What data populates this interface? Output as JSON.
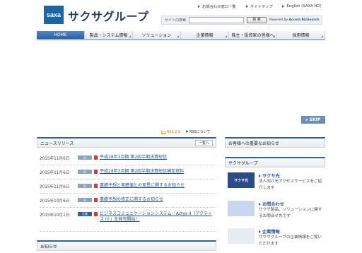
{
  "header": {
    "logo_text": "saxa",
    "brand": "サクサグループ",
    "util_links": [
      "お問合わせ窓口一覧",
      "サイトマップ",
      "English (SAXA HD)"
    ],
    "search_label": "サイト内検索",
    "search_placeholder": "",
    "search_button": "検 索",
    "powered_prefix": "Powered by",
    "powered_by": "Accela BizSearch"
  },
  "nav": [
    "HOME",
    "製品・システム情報",
    "ソリューション",
    "企業情報",
    "株主・投資家の皆様へ",
    "採用情報"
  ],
  "skip_label": "SKIP",
  "rss": {
    "badge": "RSS 2.0",
    "about": "RSSについて"
  },
  "news": {
    "heading": "ニュースリリース",
    "more": "一覧へ",
    "items": [
      {
        "date": "2015年11月6日",
        "tag": "IR",
        "title": "平成28年3月期 第2四半期決算短信"
      },
      {
        "date": "2015年11月6日",
        "tag": "IR",
        "title": "平成28年3月期 第2四半期決算短信補足資料"
      },
      {
        "date": "2015年11月6日",
        "tag": "IR",
        "title": "業績予想と実績値との差異に関するお知らせ"
      },
      {
        "date": "2015年10月6日",
        "tag": "IR",
        "title": "業績予想の修正に関するお知らせ"
      },
      {
        "date": "2015年10月1日",
        "tag": "企業",
        "title": "ビジネスコミュニケーションシステム「Actys II（アクティス II）」を発売開始！"
      }
    ]
  },
  "notice_heading": "お知らせ",
  "sidebar": {
    "important_heading": "お客様への重要なお知らせ",
    "group_heading": "サクサグループ",
    "items": [
      {
        "img": "サクサ光",
        "title": "サクサ光",
        "desc": "法人向け光アクセスサービスをご紹介します"
      },
      {
        "img": "",
        "title": "お問合わせ",
        "desc": "サクサ製品、ソリューションに関するお問合せ先です"
      },
      {
        "img": "",
        "title": "企業情報",
        "desc": "サクサグループの企業情報をご覧いただけます"
      }
    ]
  }
}
